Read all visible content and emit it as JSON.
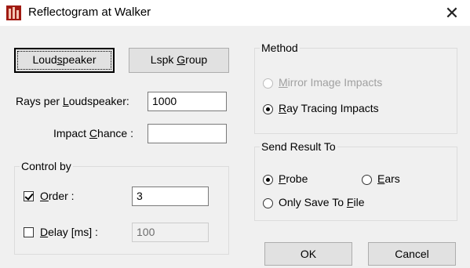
{
  "window": {
    "title": "Reflectogram at Walker",
    "close_glyph": "✕",
    "icon": "app-icon"
  },
  "buttons": {
    "loudspeaker": {
      "pre": "Loud",
      "ul": "s",
      "post": "peaker"
    },
    "lspk_group": {
      "pre": "Lspk ",
      "ul": "G",
      "post": "roup"
    },
    "ok": "OK",
    "cancel": "Cancel"
  },
  "fields": {
    "rays_label": {
      "pre": "Rays per ",
      "ul": "L",
      "post": "oudspeaker:"
    },
    "rays_value": "1000",
    "impact_label": {
      "pre": "Impact ",
      "ul": "C",
      "post": "hance :"
    },
    "impact_value": ""
  },
  "control_by": {
    "title": "Control by",
    "order": {
      "ul": "O",
      "post": "rder :",
      "checked": true,
      "value": "3"
    },
    "delay": {
      "ul": "D",
      "post": "elay [ms] :",
      "checked": false,
      "value": "100"
    }
  },
  "method": {
    "title": "Method",
    "mirror": {
      "ul": "M",
      "post": "irror Image Impacts",
      "selected": false,
      "enabled": false
    },
    "ray_tracing": {
      "ul": "R",
      "post": "ay Tracing Impacts",
      "selected": true,
      "enabled": true
    }
  },
  "send_result": {
    "title": "Send Result To",
    "probe": {
      "ul": "P",
      "post": "robe",
      "selected": true
    },
    "ears": {
      "ul": "E",
      "post": "ars",
      "selected": false
    },
    "file": {
      "pre": "Only Save To ",
      "ul": "F",
      "post": "ile",
      "selected": false
    }
  }
}
